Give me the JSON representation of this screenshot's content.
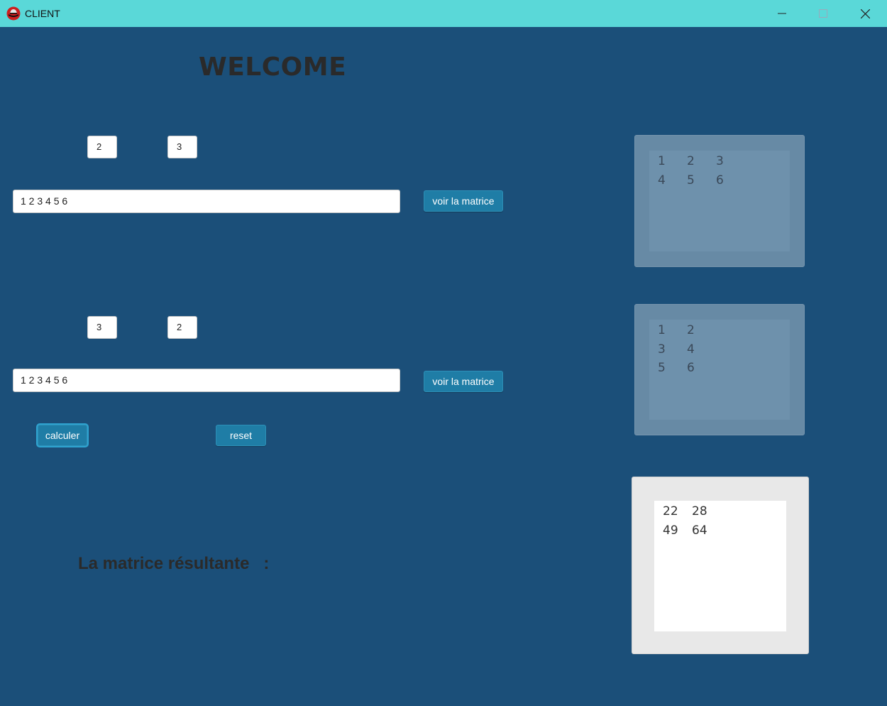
{
  "window": {
    "title": "CLIENT",
    "icon": "redhat-logo-icon",
    "controls": [
      "minimize-icon",
      "maximize-icon",
      "close-icon"
    ],
    "titlebar_color": "#5ad8d8",
    "background_color": "#1b4f79"
  },
  "heading": "WELCOME",
  "matrix_a": {
    "rows_value": "2",
    "cols_value": "3",
    "values_text": "1 2 3 4 5 6",
    "show_button": "voir la matrice",
    "display": [
      [
        "1",
        "2",
        "3"
      ],
      [
        "4",
        "5",
        "6"
      ]
    ]
  },
  "matrix_b": {
    "rows_value": "3",
    "cols_value": "2",
    "values_text": "1 2 3 4 5 6",
    "show_button": "voir la matrice",
    "display": [
      [
        "1",
        "2"
      ],
      [
        "3",
        "4"
      ],
      [
        "5",
        "6"
      ]
    ]
  },
  "actions": {
    "calculate": "calculer",
    "reset": "reset"
  },
  "result": {
    "label": "La matrice résultante   :",
    "display": [
      [
        "22",
        "28"
      ],
      [
        "49",
        "64"
      ]
    ]
  }
}
